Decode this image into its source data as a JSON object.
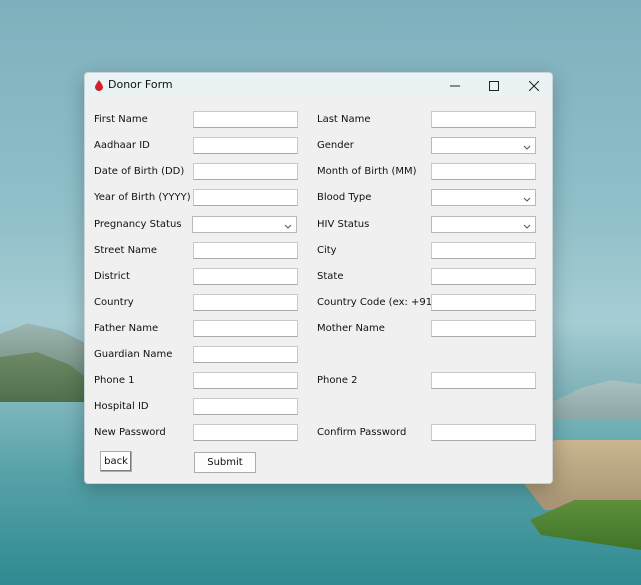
{
  "window": {
    "title": "Donor Form",
    "controls": {
      "minimize": "minimize",
      "maximize": "maximize",
      "close": "close"
    }
  },
  "icons": {
    "app": "blood-drop-icon",
    "minimize": "minimize-icon",
    "maximize": "maximize-icon",
    "close": "close-icon",
    "dropdown": "chevron-down-icon"
  },
  "colors": {
    "window_bg": "#f0f0f0",
    "titlebar_bg": "#eaf2f4",
    "blood_drop": "#d21f2f"
  },
  "form": {
    "first_name": {
      "label": "First Name",
      "value": ""
    },
    "last_name": {
      "label": "Last Name",
      "value": ""
    },
    "aadhaar_id": {
      "label": "Aadhaar ID",
      "value": ""
    },
    "gender": {
      "label": "Gender",
      "value": ""
    },
    "dob_day": {
      "label": "Date of Birth (DD)",
      "value": ""
    },
    "dob_month": {
      "label": "Month of Birth (MM)",
      "value": ""
    },
    "dob_year": {
      "label": "Year of Birth (YYYY)",
      "value": ""
    },
    "blood_type": {
      "label": "Blood Type",
      "value": ""
    },
    "pregnancy_status": {
      "label": "Pregnancy Status",
      "value": ""
    },
    "hiv_status": {
      "label": "HIV Status",
      "value": ""
    },
    "street_name": {
      "label": "Street Name",
      "value": ""
    },
    "city": {
      "label": "City",
      "value": ""
    },
    "district": {
      "label": "District",
      "value": ""
    },
    "state": {
      "label": "State",
      "value": ""
    },
    "country": {
      "label": "Country",
      "value": ""
    },
    "country_code": {
      "label": "Country Code (ex: +91)",
      "value": ""
    },
    "father_name": {
      "label": "Father Name",
      "value": ""
    },
    "mother_name": {
      "label": "Mother Name",
      "value": ""
    },
    "guardian_name": {
      "label": "Guardian Name",
      "value": ""
    },
    "phone1": {
      "label": "Phone 1",
      "value": ""
    },
    "phone2": {
      "label": "Phone 2",
      "value": ""
    },
    "hospital_id": {
      "label": "Hospital ID",
      "value": ""
    },
    "new_password": {
      "label": "New Password",
      "value": ""
    },
    "confirm_password": {
      "label": "Confirm Password",
      "value": ""
    }
  },
  "buttons": {
    "back": "back",
    "submit": "Submit"
  }
}
